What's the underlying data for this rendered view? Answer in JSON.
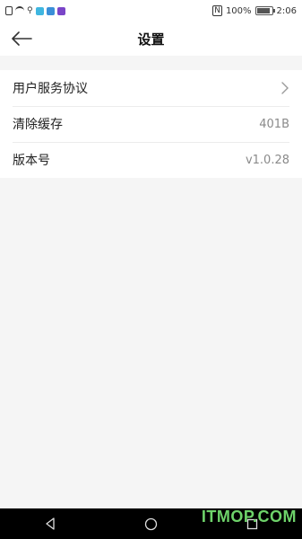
{
  "status_bar": {
    "battery_percent": "100%",
    "time": "2:06",
    "battery_level": 1.0
  },
  "nav": {
    "title": "设置"
  },
  "settings": {
    "items": [
      {
        "label": "用户服务协议",
        "value": ""
      },
      {
        "label": "清除缓存",
        "value": "401B"
      },
      {
        "label": "版本号",
        "value": "v1.0.28"
      }
    ]
  },
  "watermark": "ITMOP.COM",
  "icons": [
    "back-arrow-icon",
    "chevron-right-icon",
    "nav-back-icon",
    "nav-home-icon",
    "nav-recents-icon"
  ]
}
